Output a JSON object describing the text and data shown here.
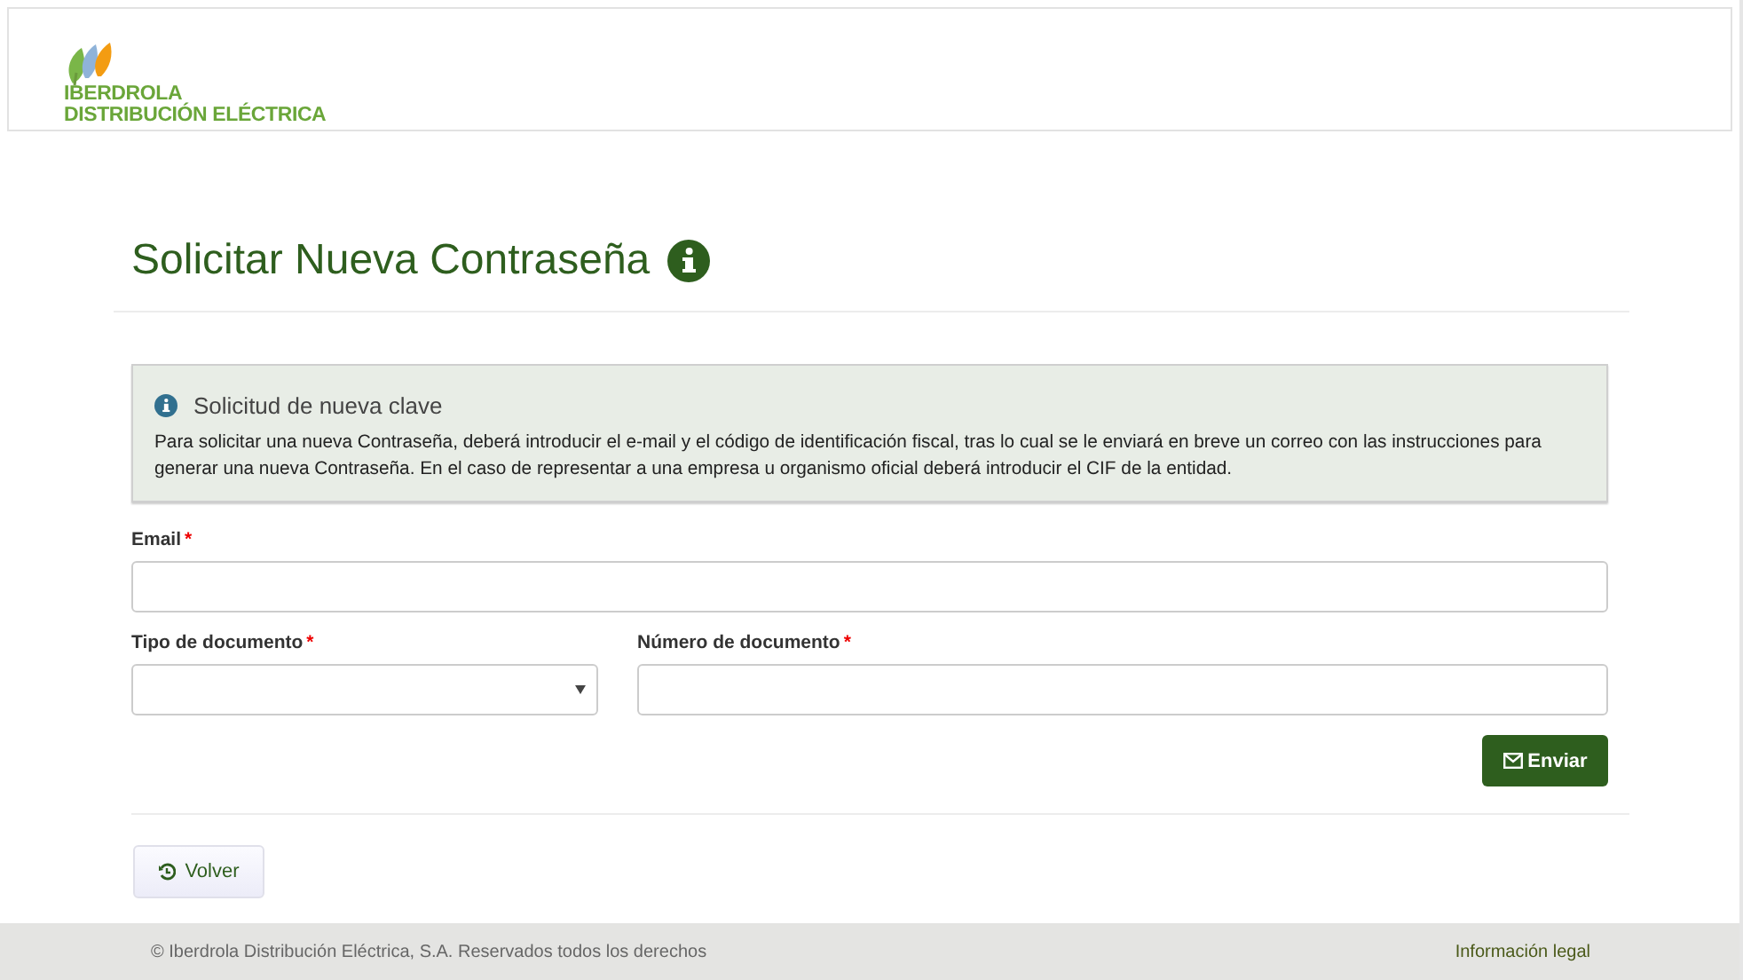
{
  "header": {
    "logo_lines": [
      "IBERDROLA",
      "DISTRIBUCIÓN ELÉCTRICA"
    ]
  },
  "page_title": "Solicitar Nueva Contraseña",
  "notice": {
    "title": "Solicitud de nueva clave",
    "text": "Para solicitar una nueva Contraseña, deberá introducir el e-mail y el código de identificación fiscal, tras lo cual se le enviará en breve un correo con las instrucciones para generar una nueva Contraseña. En el caso de representar a una empresa u organismo oficial deberá introducir el CIF de la entidad."
  },
  "field_rows": [
    [
      {
        "kind": "text",
        "label": "Email",
        "required_mark": "*"
      }
    ],
    [
      {
        "kind": "select",
        "label": "Tipo de documento",
        "required_mark": "*"
      },
      {
        "kind": "text",
        "label": "Número de documento",
        "required_mark": "*"
      }
    ]
  ],
  "submit_button": "Enviar",
  "back_button": "Volver",
  "footer": {
    "copyright": "© Iberdrola Distribución Eléctrica, S.A. Reservados todos los derechos",
    "legal_link": "Información legal"
  }
}
